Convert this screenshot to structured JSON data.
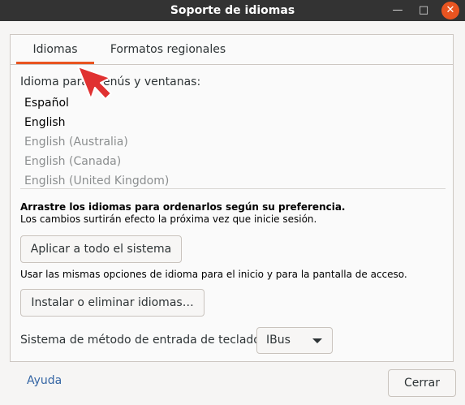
{
  "window": {
    "title": "Soporte de idiomas"
  },
  "tabs": [
    {
      "label": "Idiomas"
    },
    {
      "label": "Formatos regionales"
    }
  ],
  "languages_section": {
    "label": "Idioma para menús y ventanas:",
    "items": [
      {
        "label": "Español",
        "state": "active"
      },
      {
        "label": "English",
        "state": "active"
      },
      {
        "label": "English (Australia)",
        "state": "inactive"
      },
      {
        "label": "English (Canada)",
        "state": "inactive"
      },
      {
        "label": "English (United Kingdom)",
        "state": "inactive"
      }
    ],
    "hint_bold": "Arrastre los idiomas para ordenarlos según su preferencia.",
    "hint": "Los cambios surtirán efecto la próxima vez que inicie sesión."
  },
  "actions": {
    "apply_label": "Aplicar a todo el sistema",
    "apply_hint": "Usar las mismas opciones de idioma para el inicio y para la pantalla de acceso.",
    "install_label": "Instalar o eliminar idiomas…"
  },
  "input_method": {
    "label": "Sistema de método de entrada de teclado:",
    "value": "IBus"
  },
  "footer": {
    "help_label": "Ayuda",
    "close_label": "Cerrar"
  },
  "colors": {
    "accent": "#e95420",
    "titlebar": "#333333",
    "link": "#3465a4"
  }
}
